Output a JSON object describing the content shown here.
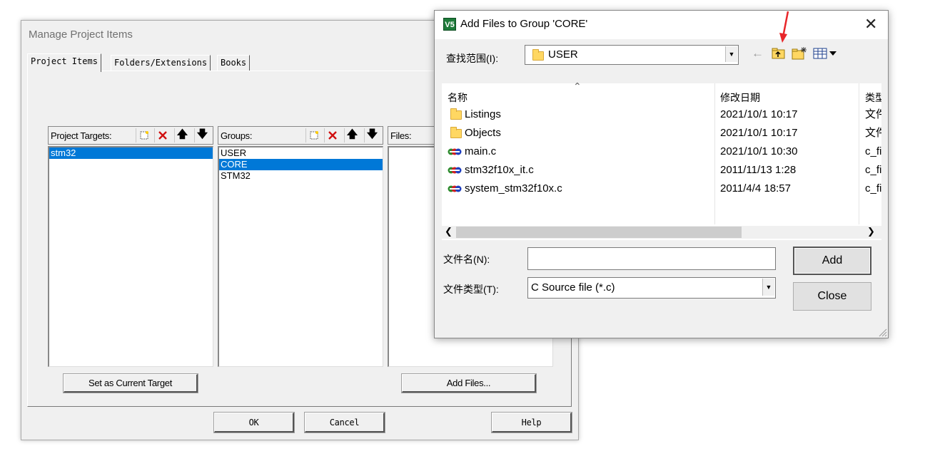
{
  "manage_window": {
    "title": "Manage Project Items",
    "tabs": [
      {
        "label": "Project Items"
      },
      {
        "label": "Folders/Extensions"
      },
      {
        "label": "Books"
      }
    ],
    "project_targets": {
      "label": "Project Targets:",
      "items": [
        "stm32"
      ],
      "selected": "stm32"
    },
    "groups": {
      "label": "Groups:",
      "items": [
        "USER",
        "CORE",
        "STM32"
      ],
      "selected": "CORE"
    },
    "files": {
      "label": "Files:"
    },
    "set_target_label": "Set as Current Target",
    "add_files_label": "Add Files...",
    "ok_label": "OK",
    "cancel_label": "Cancel",
    "help_label": "Help"
  },
  "add_dialog": {
    "app_icon_text": "V5",
    "title": "Add Files to Group 'CORE'",
    "look_in_label": "查找范围(I):",
    "look_in_value": "USER",
    "columns": {
      "name": "名称",
      "date": "修改日期",
      "type": "类型"
    },
    "entries": [
      {
        "icon": "folder-icon",
        "name": "Listings",
        "date": "2021/10/1 10:17",
        "type": "文件夹"
      },
      {
        "icon": "folder-icon",
        "name": "Objects",
        "date": "2021/10/1 10:17",
        "type": "文件夹"
      },
      {
        "icon": "c-source-icon",
        "name": "main.c",
        "date": "2021/10/1 10:30",
        "type": "c_file"
      },
      {
        "icon": "c-source-icon",
        "name": "stm32f10x_it.c",
        "date": "2011/11/13 1:28",
        "type": "c_file"
      },
      {
        "icon": "c-source-icon",
        "name": "system_stm32f10x.c",
        "date": "2011/4/4 18:57",
        "type": "c_file"
      }
    ],
    "filename_label": "文件名(N):",
    "filename_value": "",
    "filetype_label": "文件类型(T):",
    "filetype_value": "C Source file (*.c)",
    "add_label": "Add",
    "close_label": "Close"
  },
  "colors": {
    "selection": "#0078d7",
    "annotation_arrow": "#e8262a",
    "folder": "#ffd762"
  }
}
